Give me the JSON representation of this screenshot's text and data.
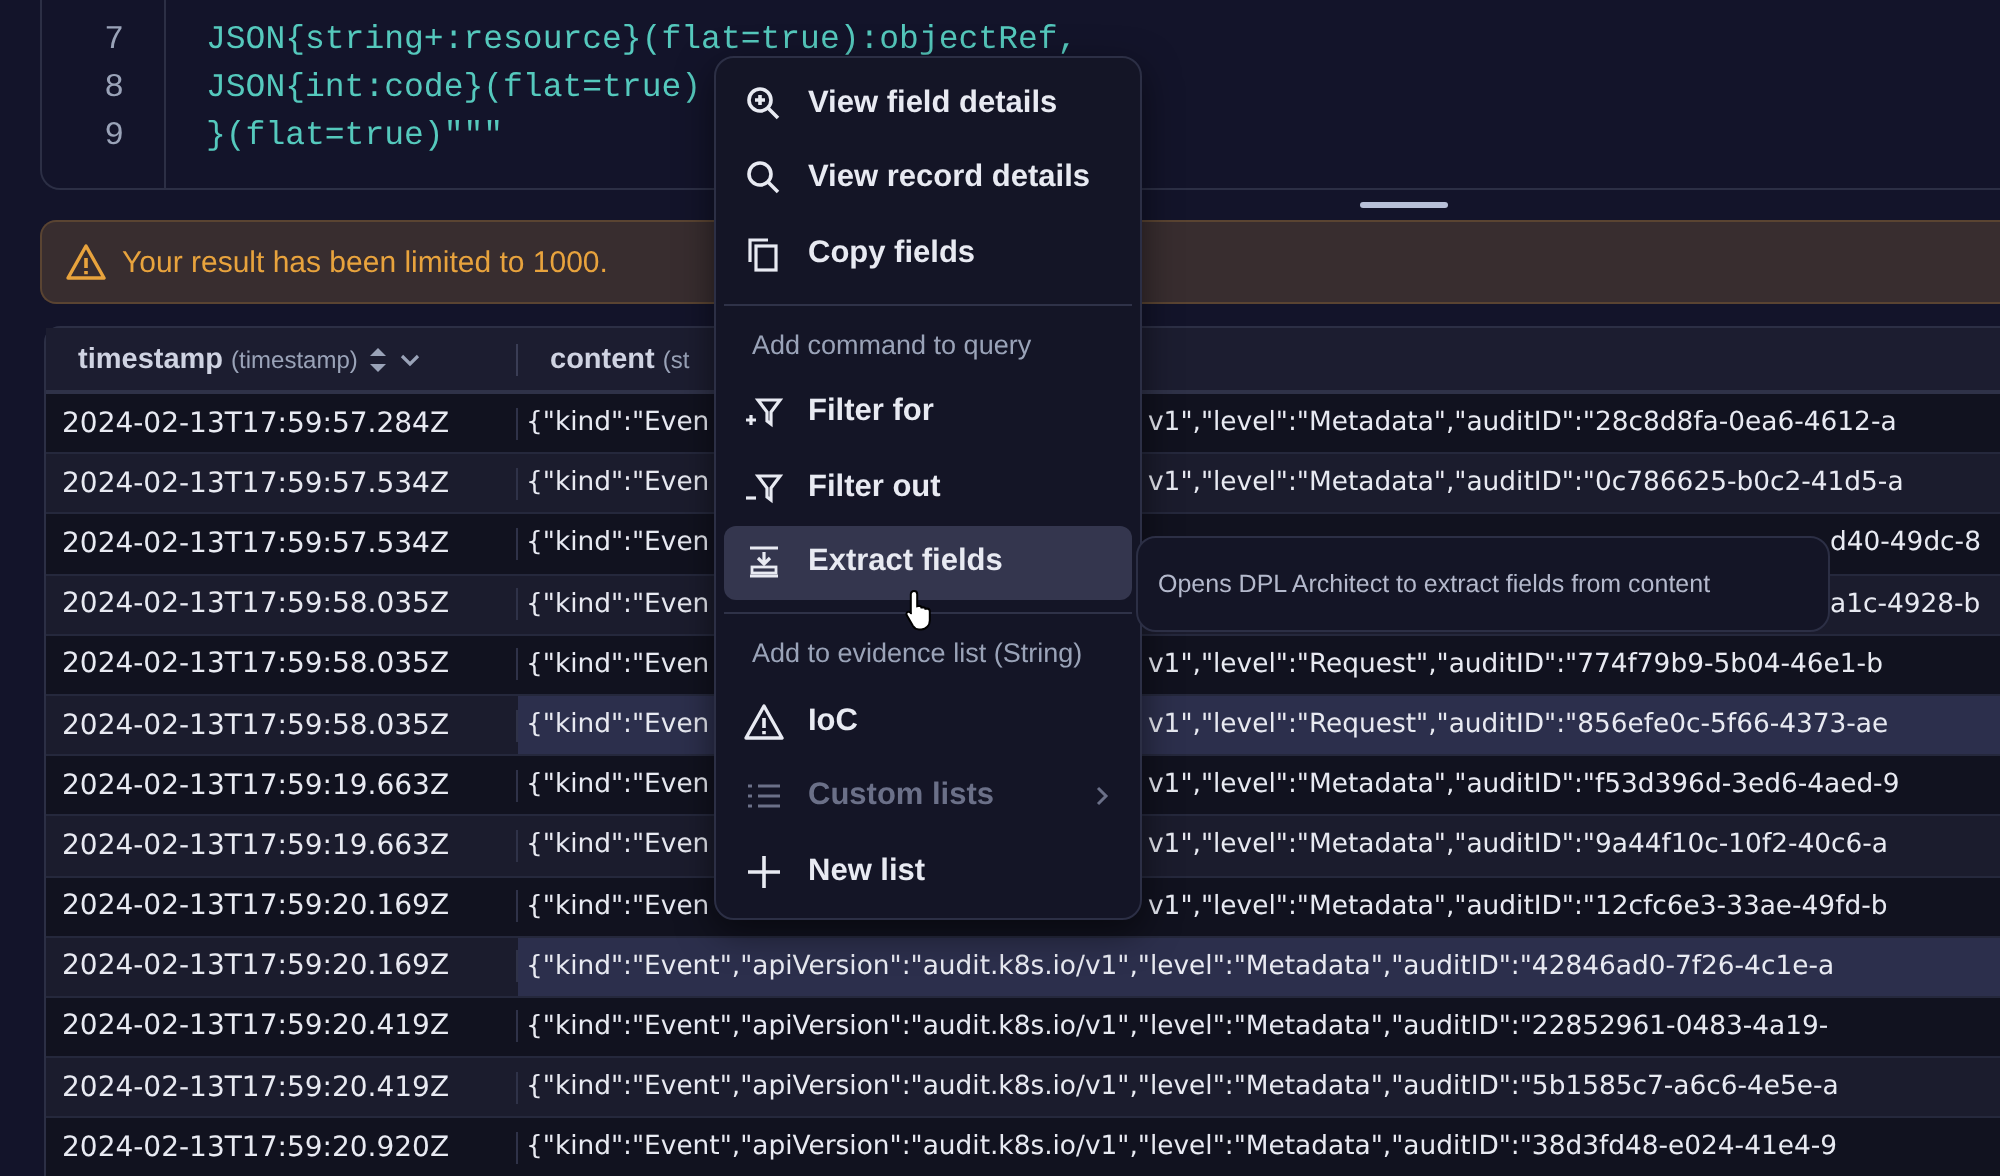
{
  "editor": {
    "lines": [
      {
        "number": "7",
        "code": "JSON{string+:resource}(flat=true):objectRef,"
      },
      {
        "number": "8",
        "code": "JSON{int:code}(flat=true)"
      },
      {
        "number": "9",
        "code": "}(flat=true)\"\"\""
      }
    ]
  },
  "warning": {
    "text": "Your result has been limited to 1000."
  },
  "table": {
    "columns": [
      {
        "name": "timestamp",
        "type": "(timestamp)"
      },
      {
        "name": "content",
        "type": "(st"
      }
    ],
    "rows": [
      {
        "kind": "under-menu",
        "selected": false,
        "timestamp": "2024-02-13T17:59:57.284Z",
        "content": [
          "{\"kind\":\"Even",
          "v1\",\"level\":\"Metadata\",\"auditID\":\"28c8d8fa-0ea6-4612-a"
        ]
      },
      {
        "kind": "under-menu",
        "selected": false,
        "timestamp": "2024-02-13T17:59:57.534Z",
        "content": [
          "{\"kind\":\"Even",
          "v1\",\"level\":\"Metadata\",\"auditID\":\"0c786625-b0c2-41d5-a"
        ]
      },
      {
        "kind": "under-tooltip",
        "selected": false,
        "timestamp": "2024-02-13T17:59:57.534Z",
        "content": [
          "{\"kind\":\"Even",
          "d40-49dc-8"
        ]
      },
      {
        "kind": "under-tooltip",
        "selected": false,
        "timestamp": "2024-02-13T17:59:58.035Z",
        "content": [
          "{\"kind\":\"Even",
          "a1c-4928-b"
        ]
      },
      {
        "kind": "under-menu",
        "selected": false,
        "timestamp": "2024-02-13T17:59:58.035Z",
        "content": [
          "{\"kind\":\"Even",
          "v1\",\"level\":\"Request\",\"auditID\":\"774f79b9-5b04-46e1-b"
        ]
      },
      {
        "kind": "under-menu",
        "selected": true,
        "timestamp": "2024-02-13T17:59:58.035Z",
        "content": [
          "{\"kind\":\"Even",
          "v1\",\"level\":\"Request\",\"auditID\":\"856efe0c-5f66-4373-ae"
        ]
      },
      {
        "kind": "under-menu",
        "selected": false,
        "timestamp": "2024-02-13T17:59:19.663Z",
        "content": [
          "{\"kind\":\"Even",
          "v1\",\"level\":\"Metadata\",\"auditID\":\"f53d396d-3ed6-4aed-9"
        ]
      },
      {
        "kind": "under-menu",
        "selected": false,
        "timestamp": "2024-02-13T17:59:19.663Z",
        "content": [
          "{\"kind\":\"Even",
          "v1\",\"level\":\"Metadata\",\"auditID\":\"9a44f10c-10f2-40c6-a"
        ]
      },
      {
        "kind": "under-menu",
        "selected": false,
        "timestamp": "2024-02-13T17:59:20.169Z",
        "content": [
          "{\"kind\":\"Even",
          "v1\",\"level\":\"Metadata\",\"auditID\":\"12cfc6e3-33ae-49fd-b"
        ]
      },
      {
        "kind": "full",
        "selected": true,
        "timestamp": "2024-02-13T17:59:20.169Z",
        "content": [
          "{\"kind\":\"Event\",\"apiVersion\":\"audit.k8s.io/v1\",\"level\":\"Metadata\",\"auditID\":\"42846ad0-7f26-4c1e-a"
        ]
      },
      {
        "kind": "full",
        "selected": false,
        "timestamp": "2024-02-13T17:59:20.419Z",
        "content": [
          "{\"kind\":\"Event\",\"apiVersion\":\"audit.k8s.io/v1\",\"level\":\"Metadata\",\"auditID\":\"22852961-0483-4a19-"
        ]
      },
      {
        "kind": "full",
        "selected": false,
        "timestamp": "2024-02-13T17:59:20.419Z",
        "content": [
          "{\"kind\":\"Event\",\"apiVersion\":\"audit.k8s.io/v1\",\"level\":\"Metadata\",\"auditID\":\"5b1585c7-a6c6-4e5e-a"
        ]
      },
      {
        "kind": "full",
        "selected": false,
        "timestamp": "2024-02-13T17:59:20.920Z",
        "content": [
          "{\"kind\":\"Event\",\"apiVersion\":\"audit.k8s.io/v1\",\"level\":\"Metadata\",\"auditID\":\"38d3fd48-e024-41e4-9"
        ]
      }
    ]
  },
  "context_menu": {
    "items": [
      {
        "kind": "item",
        "label": "View field details",
        "selected": false,
        "disabled": false
      },
      {
        "kind": "item",
        "label": "View record details",
        "selected": false,
        "disabled": false
      },
      {
        "kind": "item",
        "label": "Copy fields",
        "selected": false,
        "disabled": false
      },
      {
        "kind": "divider"
      },
      {
        "kind": "header",
        "label": "Add command to query"
      },
      {
        "kind": "item",
        "label": "Filter for",
        "selected": false,
        "disabled": false
      },
      {
        "kind": "item",
        "label": "Filter out",
        "selected": false,
        "disabled": false
      },
      {
        "kind": "item",
        "label": "Extract fields",
        "selected": true,
        "disabled": false
      },
      {
        "kind": "divider"
      },
      {
        "kind": "header",
        "label": "Add to evidence list (String)"
      },
      {
        "kind": "item",
        "label": "IoC",
        "selected": false,
        "disabled": false
      },
      {
        "kind": "item",
        "label": "Custom lists",
        "selected": false,
        "disabled": true,
        "submenu": true
      },
      {
        "kind": "item",
        "label": "New list",
        "selected": false,
        "disabled": false
      }
    ]
  },
  "tooltip": {
    "text": "Opens DPL Architect to extract fields from content"
  }
}
